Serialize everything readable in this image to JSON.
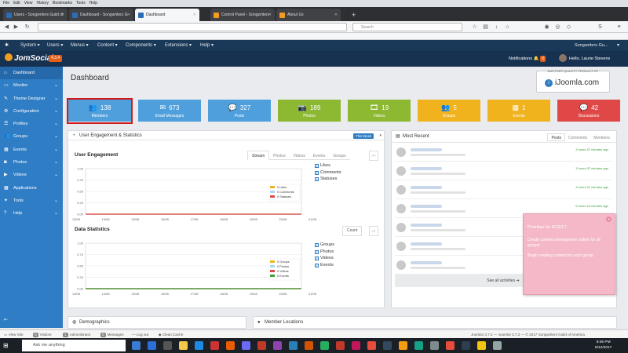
{
  "browser": {
    "menu": [
      "File",
      "Edit",
      "View",
      "History",
      "Bookmarks",
      "Tools",
      "Help"
    ],
    "tabs": [
      {
        "label": "Users - Songwriters Guild of",
        "color": "#2a6db5",
        "active": false
      },
      {
        "label": "Dashboard - Songwriters G",
        "color": "#2a6db5",
        "active": false
      },
      {
        "label": "Dashboard",
        "color": "#2a6db5",
        "active": true
      },
      {
        "label": "Control Panel - Songwriters",
        "color": "#f29d1f",
        "active": false
      },
      {
        "label": "About Us",
        "color": "#f29d1f",
        "active": false
      }
    ],
    "search_placeholder": "Search",
    "new_tab": "+"
  },
  "topbar": {
    "menus": [
      "System",
      "Users",
      "Menus",
      "Content",
      "Components",
      "Extensions",
      "Help"
    ],
    "site_name": "Songwriters Gu..."
  },
  "brand": {
    "name": "JomSocial",
    "version": "4.3.4",
    "notifications_label": "Notifications",
    "notifications_count": "0",
    "greeting": "Hello, Laurie Stevens"
  },
  "sidebar": {
    "items": [
      {
        "label": "Dashboard",
        "icon": "home-icon",
        "chevron": false,
        "active": true
      },
      {
        "label": "Monitor",
        "icon": "monitor-icon",
        "chevron": true,
        "active": false
      },
      {
        "label": "Theme Designer",
        "icon": "brush-icon",
        "chevron": true,
        "active": false
      },
      {
        "label": "Configuration",
        "icon": "gear-icon",
        "chevron": true,
        "active": false
      },
      {
        "label": "Profiles",
        "icon": "profile-icon",
        "chevron": true,
        "active": false
      },
      {
        "label": "Groups",
        "icon": "groups-icon",
        "chevron": true,
        "active": false
      },
      {
        "label": "Events",
        "icon": "events-icon",
        "chevron": true,
        "active": false
      },
      {
        "label": "Photos",
        "icon": "photo-icon",
        "chevron": true,
        "active": false
      },
      {
        "label": "Videos",
        "icon": "video-icon",
        "chevron": true,
        "active": false
      },
      {
        "label": "Applications",
        "icon": "apps-icon",
        "chevron": false,
        "active": false
      },
      {
        "label": "Tools",
        "icon": "wrench-icon",
        "chevron": true,
        "active": false
      },
      {
        "label": "Help",
        "icon": "help-icon",
        "chevron": true,
        "active": false
      }
    ]
  },
  "main": {
    "title": "Dashboard",
    "promo_small": "ANOTHER QUALITY PRODUCT BY",
    "promo_big": "iJoomla.com"
  },
  "stats": [
    {
      "value": "138",
      "label": "Members",
      "color": "#4f9fdc",
      "icon": "members-icon"
    },
    {
      "value": "673",
      "label": "Email Messages",
      "color": "#4f9fdc",
      "icon": "envelope-icon"
    },
    {
      "value": "327",
      "label": "Posts",
      "color": "#4f9fdc",
      "icon": "comment-icon"
    },
    {
      "value": "189",
      "label": "Photos",
      "color": "#8cb832",
      "icon": "camera-icon"
    },
    {
      "value": "19",
      "label": "Videos",
      "color": "#8cb832",
      "icon": "film-icon"
    },
    {
      "value": "5",
      "label": "Groups",
      "color": "#f0b21d",
      "icon": "groups-icon"
    },
    {
      "value": "1",
      "label": "Events",
      "color": "#f0b21d",
      "icon": "calendar-icon"
    },
    {
      "value": "42",
      "label": "Discussions",
      "color": "#e04848",
      "icon": "discussion-icon"
    }
  ],
  "engagement": {
    "panel_title": "User Engagement & Statistics",
    "range_button": "This Week",
    "section1_title": "User Engagement",
    "tabs": [
      "Stream",
      "Photos",
      "Videos",
      "Events",
      "Groups"
    ],
    "checks": [
      "Likes",
      "Comments",
      "Statuses"
    ],
    "legend": [
      "0 Likes",
      "0 Comments",
      "0 Statuses"
    ],
    "section2_title": "Data Statistics",
    "count_button": "Count",
    "checks2": [
      "Groups",
      "Photos",
      "Videos",
      "Events"
    ],
    "legend2": [
      "0 Groups",
      "0 Photos",
      "0 Videos",
      "0 Events"
    ]
  },
  "chart_data": [
    {
      "type": "line",
      "title": "User Engagement",
      "categories": [
        "13/08",
        "14/08",
        "15/08",
        "16/08",
        "17/08",
        "18/08",
        "19/08",
        "20/08",
        "21/08"
      ],
      "yticks": [
        "1.00",
        "0.75",
        "0.50",
        "0.25",
        "0.00"
      ],
      "ylim": [
        0,
        1
      ],
      "series": [
        {
          "name": "Likes",
          "color": "#f0b21d",
          "values": [
            0,
            0,
            0,
            0,
            0,
            0,
            0,
            0,
            0
          ]
        },
        {
          "name": "Comments",
          "color": "#a9d4f2",
          "values": [
            0,
            0,
            0,
            0,
            0,
            0,
            0,
            0,
            0
          ]
        },
        {
          "name": "Statuses",
          "color": "#e04848",
          "values": [
            0,
            0,
            0,
            0,
            0,
            0,
            0,
            0,
            0
          ]
        }
      ]
    },
    {
      "type": "line",
      "title": "Data Statistics",
      "categories": [
        "13/08",
        "14/08",
        "15/08",
        "16/08",
        "17/08",
        "18/08",
        "19/08",
        "20/08",
        "21/08"
      ],
      "yticks": [
        "1.00",
        "0.75",
        "0.50",
        "0.25",
        "0.00"
      ],
      "ylim": [
        0,
        1
      ],
      "series": [
        {
          "name": "Groups",
          "color": "#f0b21d",
          "values": [
            0,
            0,
            0,
            0,
            0,
            0,
            0,
            0,
            0
          ]
        },
        {
          "name": "Photos",
          "color": "#a9d4f2",
          "values": [
            0,
            0,
            0,
            0,
            0,
            0,
            0,
            0,
            0
          ]
        },
        {
          "name": "Videos",
          "color": "#e04848",
          "values": [
            0,
            0,
            0,
            0,
            0,
            0,
            0,
            0,
            0
          ]
        },
        {
          "name": "Events",
          "color": "#3aa03a",
          "values": [
            0,
            0,
            0,
            0,
            0,
            0,
            0,
            0,
            0
          ]
        }
      ]
    }
  ],
  "recent": {
    "title": "Most Recent",
    "tabs": [
      "Posts",
      "Comments",
      "Members"
    ],
    "times": [
      "3 hours 57 minutes ago",
      "3 hours 57 minutes ago",
      "3 hours 57 minutes ago",
      "5 hours 24 minutes ago",
      "",
      "",
      ""
    ],
    "see_all": "See all activities"
  },
  "note": {
    "title": "Priorities for 6/12/17--",
    "line1": "Create content development outline for all groups.",
    "line2": "Begin creating content for each group."
  },
  "lower": {
    "demographics": "Demographics",
    "locations": "Member Locations"
  },
  "footer": {
    "view_site": "View Site",
    "visitors_count": "0",
    "visitors": "Visitors",
    "admin_count": "1",
    "administrator": "Administrator",
    "messages_count": "0",
    "messages": "Messages",
    "logout": "Log out",
    "clean_cache": "Clean Cache",
    "right": "Joomla! 3.7.2  —  Joomla! 3.7.2  —  © 2017 Songwriters Guild of America"
  },
  "taskbar": {
    "search_placeholder": "Ask me anything",
    "time": "8:06 PM",
    "date": "6/12/2017"
  }
}
